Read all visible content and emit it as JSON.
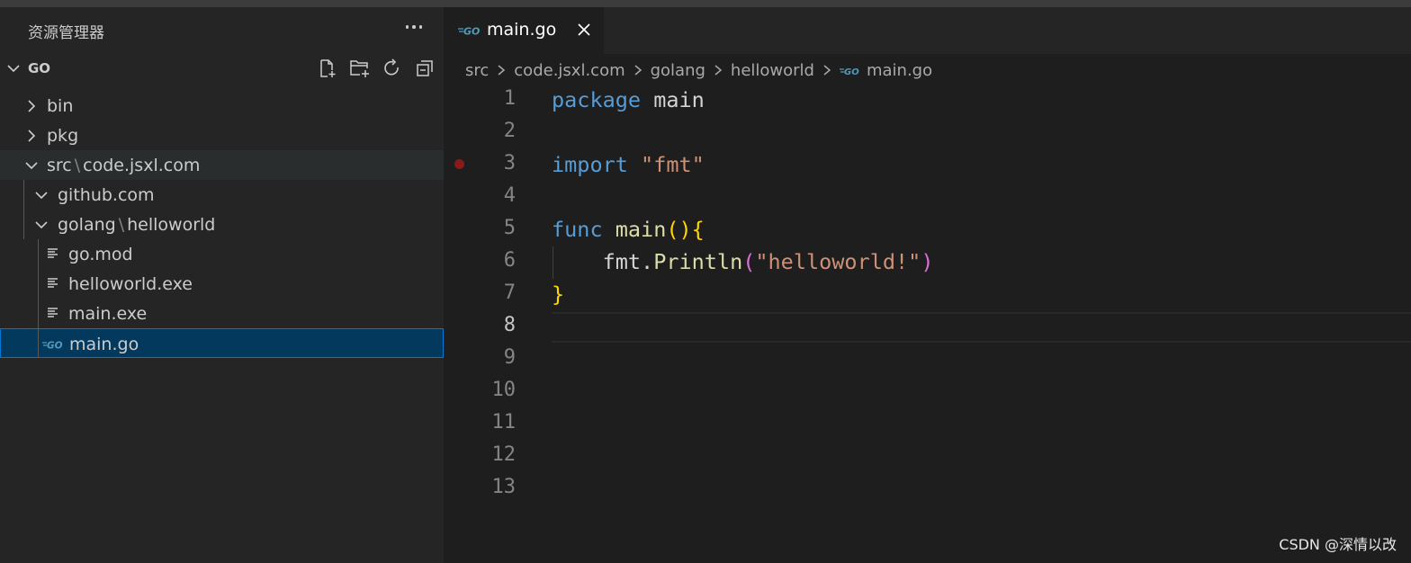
{
  "explorer": {
    "title": "资源管理器",
    "more_label": "···",
    "workspace": "GO",
    "actions": [
      "new-file-icon",
      "new-folder-icon",
      "refresh-icon",
      "collapse-all-icon"
    ],
    "tree": [
      {
        "parts": [
          "bin"
        ],
        "kind": "folder",
        "expanded": false
      },
      {
        "parts": [
          "pkg"
        ],
        "kind": "folder",
        "expanded": false
      },
      {
        "parts": [
          "src",
          "code.jsxl.com"
        ],
        "kind": "folder",
        "expanded": true
      },
      {
        "parts": [
          "github.com"
        ],
        "kind": "folder",
        "expanded": true
      },
      {
        "parts": [
          "golang",
          "helloworld"
        ],
        "kind": "folder",
        "expanded": true
      },
      {
        "parts": [
          "go.mod"
        ],
        "kind": "file"
      },
      {
        "parts": [
          "helloworld.exe"
        ],
        "kind": "file"
      },
      {
        "parts": [
          "main.exe"
        ],
        "kind": "file"
      },
      {
        "parts": [
          "main.go"
        ],
        "kind": "go-file",
        "selected": true
      }
    ],
    "path_separator": "\\"
  },
  "editor": {
    "tab": {
      "label": "main.go",
      "icon": "go-icon",
      "close_icon": "close-icon"
    },
    "breadcrumbs": [
      "src",
      "code.jsxl.com",
      "golang",
      "helloworld",
      "main.go"
    ],
    "active_line": 8,
    "breakpoint_line": 3,
    "lines": [
      {
        "n": "1",
        "tokens": [
          {
            "t": "package",
            "c": "kw"
          },
          {
            "t": " main",
            "c": "plain"
          }
        ]
      },
      {
        "n": "2",
        "tokens": []
      },
      {
        "n": "3",
        "tokens": [
          {
            "t": "import",
            "c": "kw"
          },
          {
            "t": " ",
            "c": "plain"
          },
          {
            "t": "\"fmt\"",
            "c": "str"
          }
        ]
      },
      {
        "n": "4",
        "tokens": []
      },
      {
        "n": "5",
        "tokens": [
          {
            "t": "func",
            "c": "kw"
          },
          {
            "t": " ",
            "c": "plain"
          },
          {
            "t": "main",
            "c": "fn"
          },
          {
            "t": "(){",
            "c": "br1"
          }
        ]
      },
      {
        "n": "6",
        "tokens": [
          {
            "t": "    fmt.",
            "c": "plain"
          },
          {
            "t": "Println",
            "c": "fn"
          },
          {
            "t": "(",
            "c": "br2"
          },
          {
            "t": "\"helloworld!\"",
            "c": "str"
          },
          {
            "t": ")",
            "c": "br2"
          }
        ]
      },
      {
        "n": "7",
        "tokens": [
          {
            "t": "}",
            "c": "br1"
          }
        ]
      },
      {
        "n": "8",
        "tokens": []
      },
      {
        "n": "9",
        "tokens": []
      },
      {
        "n": "10",
        "tokens": []
      },
      {
        "n": "11",
        "tokens": []
      },
      {
        "n": "12",
        "tokens": []
      },
      {
        "n": "13",
        "tokens": []
      }
    ]
  },
  "watermark": "CSDN @深情以改",
  "colors": {
    "selection": "#04395e",
    "selection_border": "#0078d4",
    "keyword": "#569cd6",
    "string": "#ce9178",
    "function": "#dcdcaa",
    "bracket1": "#ffd700",
    "bracket2": "#da70d6",
    "breakpoint": "#8b1a1a"
  }
}
